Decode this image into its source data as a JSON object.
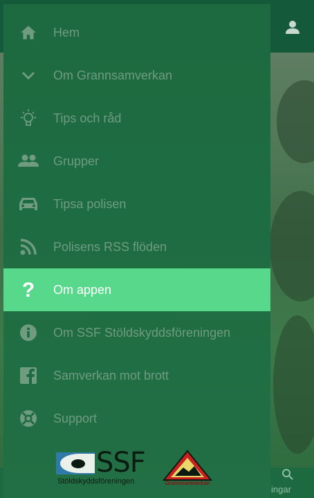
{
  "menu": {
    "items": [
      {
        "label": "Hem",
        "icon": "home-icon"
      },
      {
        "label": "Om Grannsamverkan",
        "icon": "chevron-down-icon"
      },
      {
        "label": "Tips och råd",
        "icon": "lightbulb-icon"
      },
      {
        "label": "Grupper",
        "icon": "people-icon"
      },
      {
        "label": "Tipsa polisen",
        "icon": "car-icon"
      },
      {
        "label": "Polisens RSS flöden",
        "icon": "rss-icon"
      },
      {
        "label": "Om appen",
        "icon": "question-icon",
        "active": true
      },
      {
        "label": "Om SSF Stöldskyddsföreningen",
        "icon": "info-icon"
      },
      {
        "label": "Samverkan mot brott",
        "icon": "facebook-icon"
      },
      {
        "label": "Support",
        "icon": "lifebuoy-icon"
      }
    ]
  },
  "logos": {
    "ssf_name": "SSF",
    "ssf_full": "Stöldskyddsföreningen",
    "grannsamverkan": "Grannsamverkan"
  },
  "footer": {
    "tab_label": "ingar"
  },
  "colors": {
    "drawer_bg": "#1d6a40",
    "active_bg": "#58d88b",
    "inactive_text": "#6f9b7e",
    "active_text": "#ffffff"
  }
}
